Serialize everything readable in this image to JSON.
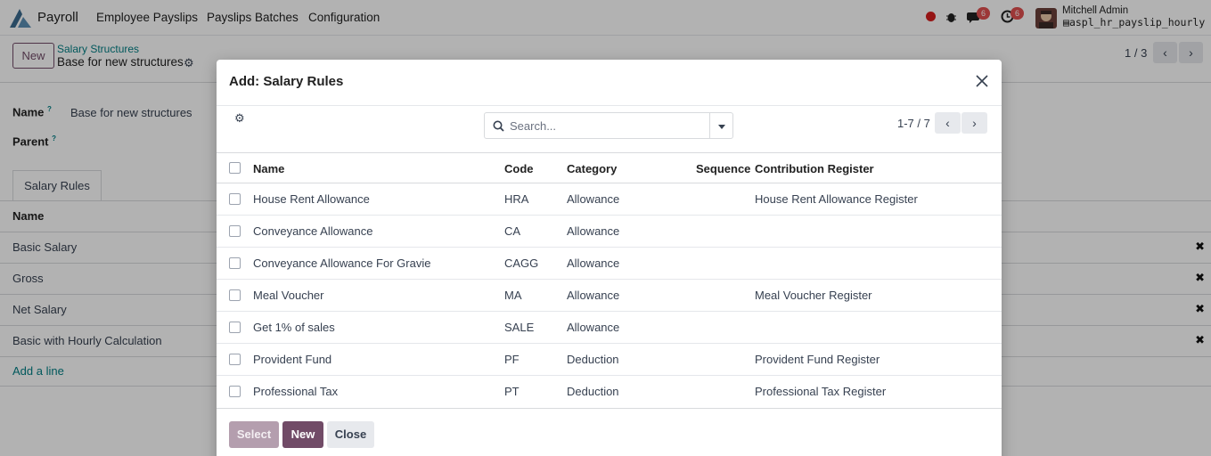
{
  "navbar": {
    "app_name": "Payroll",
    "menu": [
      "Employee Payslips",
      "Payslips Batches",
      "Configuration"
    ],
    "messages_count": "6",
    "activities_count": "6",
    "user_name": "Mitchell Admin",
    "database": "aspl_hr_payslip_hourly"
  },
  "control_panel": {
    "new_label": "New",
    "breadcrumb_parent": "Salary Structures",
    "breadcrumb_current": "Base for new structures",
    "pager": "1 / 3"
  },
  "form": {
    "name_label": "Name",
    "name_value": "Base for new structures",
    "parent_label": "Parent",
    "help_mark": "?",
    "tab_label": "Salary Rules",
    "list_header": "Name",
    "rows": [
      "Basic Salary",
      "Gross",
      "Net Salary",
      "Basic with Hourly Calculation"
    ],
    "add_line": "Add a line"
  },
  "dialog": {
    "title": "Add: Salary Rules",
    "search_placeholder": "Search...",
    "pager": "1-7 / 7",
    "columns": [
      "Name",
      "Code",
      "Category",
      "Sequence",
      "Contribution Register"
    ],
    "rows": [
      {
        "name": "House Rent Allowance",
        "code": "HRA",
        "category": "Allowance",
        "sequence": "",
        "register": "House Rent Allowance Register"
      },
      {
        "name": "Conveyance Allowance",
        "code": "CA",
        "category": "Allowance",
        "sequence": "",
        "register": ""
      },
      {
        "name": "Conveyance Allowance For Gravie",
        "code": "CAGG",
        "category": "Allowance",
        "sequence": "",
        "register": ""
      },
      {
        "name": "Meal Voucher",
        "code": "MA",
        "category": "Allowance",
        "sequence": "",
        "register": "Meal Voucher Register"
      },
      {
        "name": "Get 1% of sales",
        "code": "SALE",
        "category": "Allowance",
        "sequence": "",
        "register": ""
      },
      {
        "name": "Provident Fund",
        "code": "PF",
        "category": "Deduction",
        "sequence": "",
        "register": "Provident Fund Register"
      },
      {
        "name": "Professional Tax",
        "code": "PT",
        "category": "Deduction",
        "sequence": "",
        "register": "Professional Tax Register"
      }
    ],
    "buttons": {
      "select": "Select",
      "new": "New",
      "close": "Close"
    }
  },
  "colors": {
    "brand": "#714b67",
    "link": "#017e84",
    "badge": "#e04f4f"
  }
}
